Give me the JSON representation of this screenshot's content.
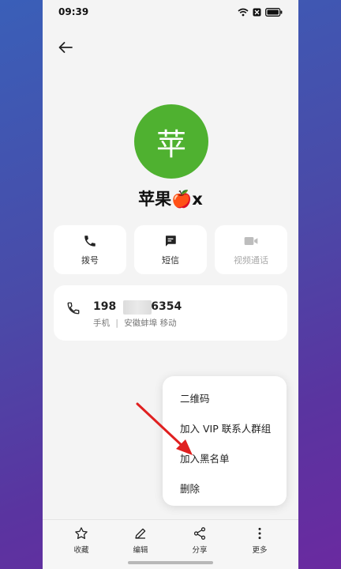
{
  "status_bar": {
    "time": "09:39"
  },
  "contact": {
    "avatar_char": "苹",
    "name": "苹果🍎x",
    "avatar_color": "#4fb130"
  },
  "actions": [
    {
      "label": "拨号",
      "icon": "phone-icon"
    },
    {
      "label": "短信",
      "icon": "message-icon"
    },
    {
      "label": "视频通话",
      "icon": "video-icon",
      "disabled": true
    }
  ],
  "number": {
    "prefix": "198",
    "suffix": "6354",
    "type": "手机",
    "separator": "|",
    "location": "安徽蚌埠 移动"
  },
  "menu": {
    "items": [
      "二维码",
      "加入 VIP 联系人群组",
      "加入黑名单",
      "删除"
    ]
  },
  "bottom_tabs": [
    {
      "label": "收藏",
      "icon": "star-icon"
    },
    {
      "label": "编辑",
      "icon": "pencil-icon"
    },
    {
      "label": "分享",
      "icon": "share-icon"
    },
    {
      "label": "更多",
      "icon": "more-icon"
    }
  ],
  "colors": {
    "accent_arrow": "#e02020"
  }
}
